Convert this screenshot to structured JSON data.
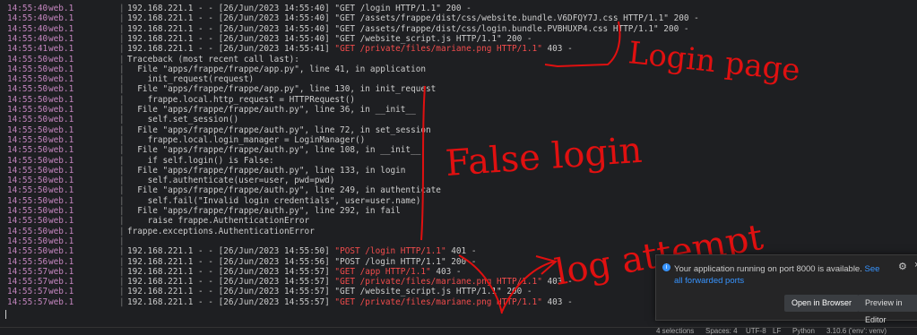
{
  "terminal": {
    "lines": [
      {
        "ts": "14:55:40",
        "proc": "web.1",
        "msg": "192.168.221.1 - - [26/Jun/2023 14:55:40] \"GET /login HTTP/1.1\" 200 -"
      },
      {
        "ts": "14:55:40",
        "proc": "web.1",
        "msg": "192.168.221.1 - - [26/Jun/2023 14:55:40] \"GET /assets/frappe/dist/css/website.bundle.V6DFQY7J.css HTTP/1.1\" 200 -"
      },
      {
        "ts": "14:55:40",
        "proc": "web.1",
        "msg": "192.168.221.1 - - [26/Jun/2023 14:55:40] \"GET /assets/frappe/dist/css/login.bundle.PVBHUXP4.css HTTP/1.1\" 200 -"
      },
      {
        "ts": "14:55:40",
        "proc": "web.1",
        "msg": "192.168.221.1 - - [26/Jun/2023 14:55:40] \"GET /website_script.js HTTP/1.1\" 200 -"
      },
      {
        "ts": "14:55:41",
        "proc": "web.1",
        "pre": "192.168.221.1 - - [26/Jun/2023 14:55:41] ",
        "hl": "\"GET /private/files/mariane.png HTTP/1.1\"",
        "post": " 403 -"
      },
      {
        "ts": "14:55:50",
        "proc": "web.1",
        "msg": "Traceback (most recent call last):"
      },
      {
        "ts": "14:55:50",
        "proc": "web.1",
        "msg": "  File \"apps/frappe/frappe/app.py\", line 41, in application"
      },
      {
        "ts": "14:55:50",
        "proc": "web.1",
        "msg": "    init_request(request)"
      },
      {
        "ts": "14:55:50",
        "proc": "web.1",
        "msg": "  File \"apps/frappe/frappe/app.py\", line 130, in init_request"
      },
      {
        "ts": "14:55:50",
        "proc": "web.1",
        "msg": "    frappe.local.http_request = HTTPRequest()"
      },
      {
        "ts": "14:55:50",
        "proc": "web.1",
        "msg": "  File \"apps/frappe/frappe/auth.py\", line 36, in __init__"
      },
      {
        "ts": "14:55:50",
        "proc": "web.1",
        "msg": "    self.set_session()"
      },
      {
        "ts": "14:55:50",
        "proc": "web.1",
        "msg": "  File \"apps/frappe/frappe/auth.py\", line 72, in set_session"
      },
      {
        "ts": "14:55:50",
        "proc": "web.1",
        "msg": "    frappe.local.login_manager = LoginManager()"
      },
      {
        "ts": "14:55:50",
        "proc": "web.1",
        "msg": "  File \"apps/frappe/frappe/auth.py\", line 108, in __init__"
      },
      {
        "ts": "14:55:50",
        "proc": "web.1",
        "msg": "    if self.login() is False:"
      },
      {
        "ts": "14:55:50",
        "proc": "web.1",
        "msg": "  File \"apps/frappe/frappe/auth.py\", line 133, in login"
      },
      {
        "ts": "14:55:50",
        "proc": "web.1",
        "msg": "    self.authenticate(user=user, pwd=pwd)"
      },
      {
        "ts": "14:55:50",
        "proc": "web.1",
        "msg": "  File \"apps/frappe/frappe/auth.py\", line 249, in authenticate"
      },
      {
        "ts": "14:55:50",
        "proc": "web.1",
        "msg": "    self.fail(\"Invalid login credentials\", user=user.name)"
      },
      {
        "ts": "14:55:50",
        "proc": "web.1",
        "msg": "  File \"apps/frappe/frappe/auth.py\", line 292, in fail"
      },
      {
        "ts": "14:55:50",
        "proc": "web.1",
        "msg": "    raise frappe.AuthenticationError"
      },
      {
        "ts": "14:55:50",
        "proc": "web.1",
        "msg": "frappe.exceptions.AuthenticationError"
      },
      {
        "ts": "14:55:50",
        "proc": "web.1",
        "msg": ""
      },
      {
        "ts": "14:55:50",
        "proc": "web.1",
        "pre": "192.168.221.1 - - [26/Jun/2023 14:55:50] ",
        "hl": "\"POST /login HTTP/1.1\"",
        "post": " 401 -"
      },
      {
        "ts": "14:55:56",
        "proc": "web.1",
        "msg": "192.168.221.1 - - [26/Jun/2023 14:55:56] \"POST /login HTTP/1.1\" 200 -"
      },
      {
        "ts": "14:55:57",
        "proc": "web.1",
        "pre": "192.168.221.1 - - [26/Jun/2023 14:55:57] ",
        "hl": "\"GET /app HTTP/1.1\"",
        "post": " 403 -"
      },
      {
        "ts": "14:55:57",
        "proc": "web.1",
        "pre": "192.168.221.1 - - [26/Jun/2023 14:55:57] ",
        "hl": "\"GET /private/files/mariane.png HTTP/1.1\"",
        "post": " 403 -"
      },
      {
        "ts": "14:55:57",
        "proc": "web.1",
        "msg": "192.168.221.1 - - [26/Jun/2023 14:55:57] \"GET /website_script.js HTTP/1.1\" 200 -"
      },
      {
        "ts": "14:55:57",
        "proc": "web.1",
        "pre": "192.168.221.1 - - [26/Jun/2023 14:55:57] ",
        "hl": "\"GET /private/files/mariane.png HTTP/1.1\"",
        "post": " 403 -"
      }
    ]
  },
  "annotations": {
    "login_page": "Login page",
    "false_login": "False login",
    "log_attempt": "log attempt"
  },
  "notification": {
    "message": "Your application running on port 8000 is available.",
    "link_a": "See all",
    "link_b": "forwarded ports",
    "open_button": "Open in Browser",
    "preview_button": "Preview in Editor"
  },
  "statusbar": {
    "selections": "4 selections",
    "spaces": "Spaces: 4",
    "encoding": "UTF-8",
    "eol": "LF",
    "language": "Python",
    "interpreter": "3.10.6 ('env': venv)"
  },
  "colors": {
    "accent": "#3794ff",
    "annotation": "#e01010",
    "highlight": "#f14c4c",
    "process": "#c586c0"
  }
}
